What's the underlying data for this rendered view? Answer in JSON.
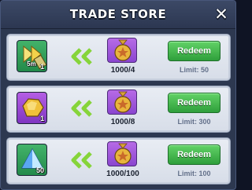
{
  "header": {
    "title": "TRADE STORE",
    "close_glyph": "✕"
  },
  "offers": [
    {
      "item_icon": "speedup-fast-forward-icon",
      "item_badge": "5m",
      "item_quantity": "1",
      "cost_icon": "gold-medal-token-icon",
      "cost": "1000/4",
      "button_label": "Redeem",
      "limit": "Limit: 50"
    },
    {
      "item_icon": "gold-ore-nugget-icon",
      "item_badge": "",
      "item_quantity": "1",
      "cost_icon": "gold-medal-token-icon",
      "cost": "1000/8",
      "button_label": "Redeem",
      "limit": "Limit: 300"
    },
    {
      "item_icon": "blue-crystal-pyramid-icon",
      "item_badge": "",
      "item_quantity": "50",
      "cost_icon": "gold-medal-token-icon",
      "cost": "1000/100",
      "button_label": "Redeem",
      "limit": "Limit: 100"
    }
  ],
  "colors": {
    "redeem_green": "#3fb24a",
    "arrow_green": "#86d43a",
    "panel_bg": "#2d3850",
    "row_bg": "#e3e8f0"
  }
}
